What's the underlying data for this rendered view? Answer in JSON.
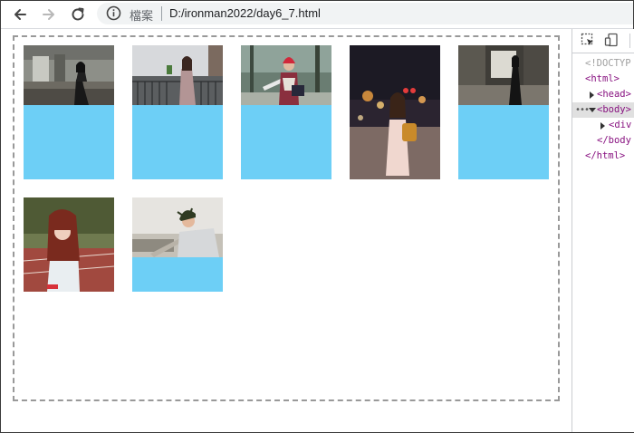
{
  "browser": {
    "security_label": "檔案",
    "url": "D:/ironman2022/day6_7.html"
  },
  "page": {
    "container_border_color": "#999999",
    "card_color": "#6dcff6",
    "cards": [
      {
        "photo": "woman-ruined-building-photo",
        "fills_card": false
      },
      {
        "photo": "woman-balcony-railing-photo",
        "fills_card": false
      },
      {
        "photo": "woman-red-beanie-forest-photo",
        "fills_card": false
      },
      {
        "photo": "woman-street-night-lights-photo",
        "fills_card": true
      },
      {
        "photo": "woman-dark-corridor-photo",
        "fills_card": false
      },
      {
        "photo": "woman-running-track-photo",
        "fills_card": true
      },
      {
        "photo": "man-leaning-sky-photo",
        "fills_card": false
      }
    ]
  },
  "devtools": {
    "dom_tree": [
      {
        "text": "<!DOCTYP",
        "kind": "doctype"
      },
      {
        "text": "<html>",
        "kind": "tag"
      },
      {
        "text": "<head>",
        "kind": "tag"
      },
      {
        "text": "<body>",
        "kind": "tag"
      },
      {
        "text": "<div",
        "kind": "tag"
      },
      {
        "text": "</body",
        "kind": "tag"
      },
      {
        "text": "</html>",
        "kind": "tag"
      }
    ],
    "dots": "•••"
  }
}
